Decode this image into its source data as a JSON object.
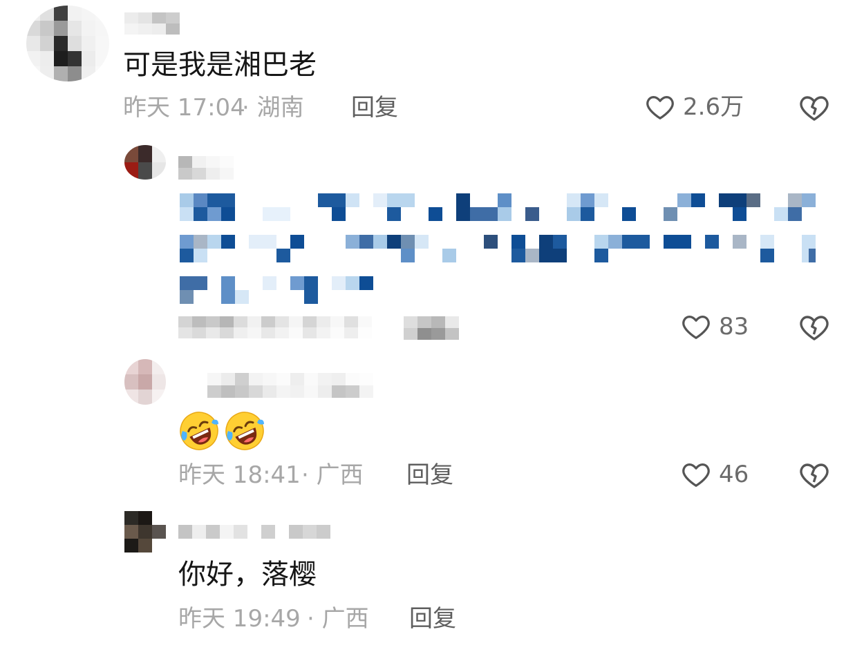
{
  "comments": [
    {
      "text": "可是我是湘巴老",
      "time": "昨天 17:04",
      "location": "· 湖南",
      "reply_label": "回复",
      "like_count": "2.6万"
    },
    {
      "text": "",
      "time": "",
      "location": "",
      "reply_label": "回复",
      "like_count": "83"
    },
    {
      "text": "",
      "time": "昨天 18:41",
      "location": "· 广西",
      "reply_label": "回复",
      "like_count": "46"
    },
    {
      "text": "你好，落樱",
      "time": "昨天 19:49",
      "location": "· 广西",
      "reply_label": "回复",
      "like_count": ""
    }
  ],
  "emoji_names": [
    "rolling-on-floor-laughing-icon",
    "rolling-on-floor-laughing-icon"
  ],
  "colors": {
    "text": "#161616",
    "meta": "#a7a7a7",
    "reply": "#5e5e5e",
    "icon": "#555555",
    "mosaic_blue": "#1d5a9e"
  }
}
